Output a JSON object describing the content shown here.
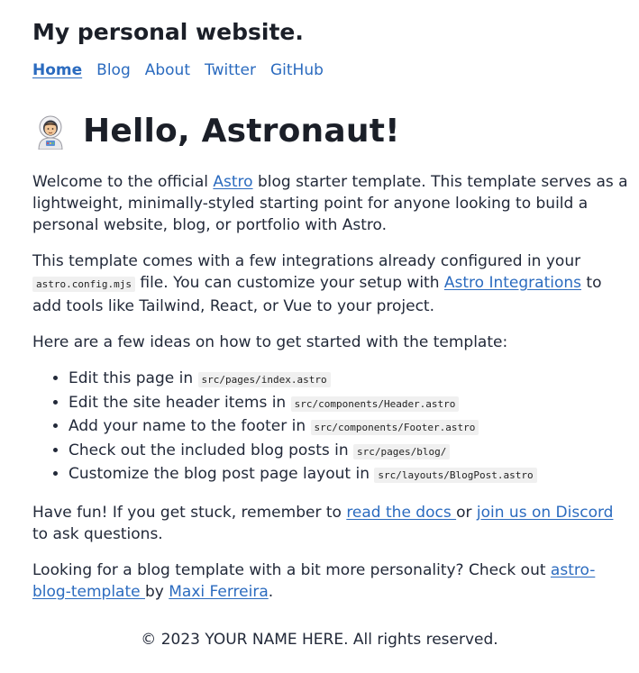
{
  "header": {
    "site_title": "My personal website.",
    "nav": [
      {
        "label": "Home",
        "active": true
      },
      {
        "label": "Blog",
        "active": false
      },
      {
        "label": "About",
        "active": false
      },
      {
        "label": "Twitter",
        "active": false
      },
      {
        "label": "GitHub",
        "active": false
      }
    ]
  },
  "hero": {
    "icon": "astronaut-icon",
    "title": "Hello, Astronaut!"
  },
  "intro": {
    "p1_before": "Welcome to the official ",
    "p1_link": "Astro",
    "p1_after": " blog starter template. This template serves as a lightweight, minimally-styled starting point for anyone looking to build a personal website, blog, or portfolio with Astro.",
    "p2_before": "This template comes with a few integrations already configured in your ",
    "p2_code": "astro.config.mjs",
    "p2_mid": " file. You can customize your setup with ",
    "p2_link": "Astro Integrations",
    "p2_after": " to add tools like Tailwind, React, or Vue to your project.",
    "p3": "Here are a few ideas on how to get started with the template:"
  },
  "ideas": [
    {
      "text": "Edit this page in ",
      "code": "src/pages/index.astro"
    },
    {
      "text": "Edit the site header items in ",
      "code": "src/components/Header.astro"
    },
    {
      "text": "Add your name to the footer in ",
      "code": "src/components/Footer.astro"
    },
    {
      "text": "Check out the included blog posts in ",
      "code": "src/pages/blog/"
    },
    {
      "text": "Customize the blog post page layout in ",
      "code": "src/layouts/BlogPost.astro"
    }
  ],
  "outro": {
    "p4_before": "Have fun! If you get stuck, remember to ",
    "p4_link1": "read the docs ",
    "p4_mid": "or ",
    "p4_link2": "join us on Discord",
    "p4_after": " to ask questions.",
    "p5_before": "Looking for a blog template with a bit more personality? Check out ",
    "p5_link1": "astro-blog-template ",
    "p5_mid": "by ",
    "p5_link2": "Maxi Ferreira",
    "p5_after": "."
  },
  "footer": {
    "text": "© 2023 YOUR NAME HERE. All rights reserved."
  },
  "colors": {
    "link": "#2b6bbf",
    "text": "#222939",
    "code_bg": "#f0f0f0"
  }
}
